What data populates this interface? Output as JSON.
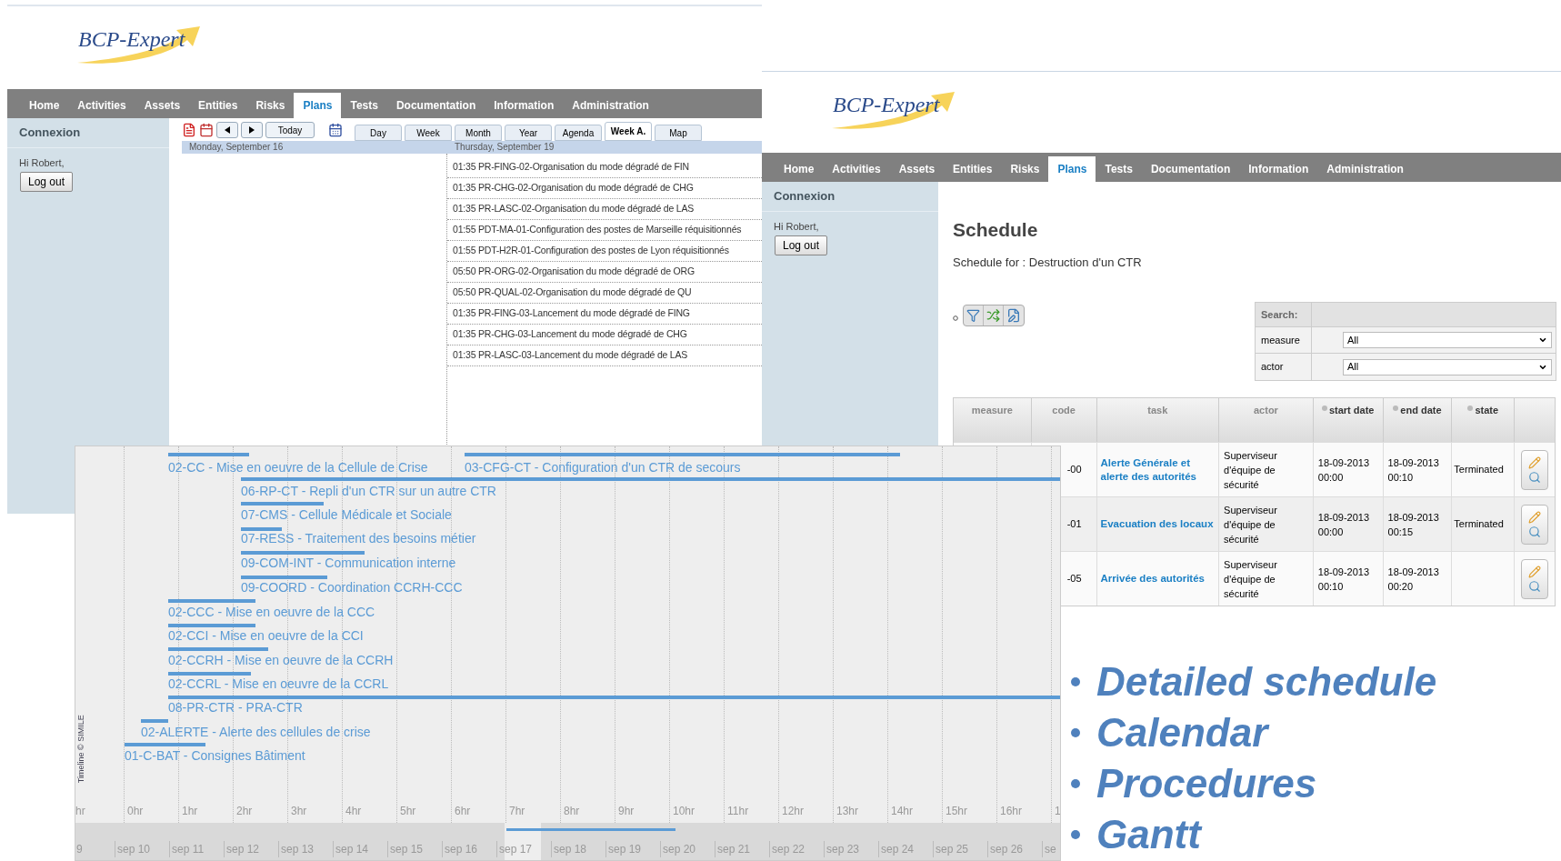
{
  "calendar_window": {
    "logo": "BCP-Expert",
    "nav": [
      {
        "label": "Home",
        "selected": false
      },
      {
        "label": "Activities",
        "selected": false
      },
      {
        "label": "Assets",
        "selected": false
      },
      {
        "label": "Entities",
        "selected": false
      },
      {
        "label": "Risks",
        "selected": false
      },
      {
        "label": "Plans",
        "selected": true
      },
      {
        "label": "Tests",
        "selected": false
      },
      {
        "label": "Documentation",
        "selected": false
      },
      {
        "label": "Information",
        "selected": false
      },
      {
        "label": "Administration",
        "selected": false
      }
    ],
    "sidebar": {
      "title": "Connexion",
      "greeting": "Hi Robert,",
      "logout": "Log out"
    },
    "toolbar": {
      "today": "Today",
      "views": [
        {
          "label": "Day",
          "selected": false
        },
        {
          "label": "Week",
          "selected": false
        },
        {
          "label": "Month",
          "selected": false
        },
        {
          "label": "Year",
          "selected": false
        },
        {
          "label": "Agenda",
          "selected": false
        },
        {
          "label": "Week A.",
          "selected": true
        },
        {
          "label": "Map",
          "selected": false
        }
      ]
    },
    "days": [
      {
        "date": "Monday, September 16"
      },
      {
        "date": "Thursday, September 19",
        "events": [
          "01:35 PR-FING-02-Organisation du mode dégradé de FIN",
          "01:35 PR-CHG-02-Organisation du mode dégradé de CHG",
          "01:35 PR-LASC-02-Organisation du mode dégradé de LAS",
          "01:55 PDT-MA-01-Configuration des postes de Marseille réquisitionnés",
          "01:55 PDT-H2R-01-Configuration des postes de Lyon réquisitionnés",
          "05:50 PR-ORG-02-Organisation du mode dégradé de ORG",
          "05:50 PR-QUAL-02-Organisation du mode dégradé de QU",
          "01:35 PR-FING-03-Lancement du mode dégradé de FING",
          "01:35 PR-CHG-03-Lancement du mode dégradé de CHG",
          "01:35 PR-LASC-03-Lancement du mode dégradé de LAS"
        ]
      }
    ]
  },
  "schedule_window": {
    "logo": "BCP-Expert",
    "nav": [
      {
        "label": "Home",
        "selected": false
      },
      {
        "label": "Activities",
        "selected": false
      },
      {
        "label": "Assets",
        "selected": false
      },
      {
        "label": "Entities",
        "selected": false
      },
      {
        "label": "Risks",
        "selected": false
      },
      {
        "label": "Plans",
        "selected": true
      },
      {
        "label": "Tests",
        "selected": false
      },
      {
        "label": "Documentation",
        "selected": false
      },
      {
        "label": "Information",
        "selected": false
      },
      {
        "label": "Administration",
        "selected": false
      }
    ],
    "sidebar": {
      "title": "Connexion",
      "greeting": "Hi Robert,",
      "logout": "Log out"
    },
    "title": "Schedule",
    "subtitle": "Schedule for : Destruction d'un CTR",
    "search": {
      "title": "Search:",
      "filters": [
        {
          "label": "measure",
          "value": "All"
        },
        {
          "label": "actor",
          "value": "All"
        }
      ]
    },
    "table": {
      "columns": [
        {
          "label": "measure",
          "sortable": false
        },
        {
          "label": "code",
          "sortable": false
        },
        {
          "label": "task",
          "sortable": false
        },
        {
          "label": "actor",
          "sortable": false
        },
        {
          "label": "start date",
          "sortable": true
        },
        {
          "label": "end date",
          "sortable": true
        },
        {
          "label": "state",
          "sortable": true
        }
      ],
      "rows": [
        {
          "code": "-00",
          "task": "Alerte Générale et alerte des autorités",
          "actor": "Superviseur d'équipe de sécurité",
          "start": "18-09-2013 00:00",
          "end": "18-09-2013 00:10",
          "state": "Terminated"
        },
        {
          "code": "-01",
          "task": "Evacuation des locaux",
          "actor": "Superviseur d'équipe de sécurité",
          "start": "18-09-2013 00:00",
          "end": "18-09-2013 00:15",
          "state": "Terminated"
        },
        {
          "code": "-05",
          "task": "Arrivée des autorités",
          "actor": "Superviseur d'équipe de sécurité",
          "start": "18-09-2013 00:10",
          "end": "18-09-2013 00:20"
        }
      ]
    }
  },
  "timeline": {
    "tasks": [
      "02-CC - Mise en oeuvre de la Cellule de Crise",
      "03-CFG-CT - Configuration d'un CTR de secours",
      "06-RP-CT - Repli d'un CTR sur un autre CTR",
      "07-CMS - Cellule Médicale et Sociale",
      "07-RESS - Traitement des besoins métier",
      "09-COM-INT - Communication interne",
      "09-COORD - Coordination CCRH-CCC",
      "02-CCC - Mise en oeuvre de la CCC",
      "02-CCI - Mise en oeuvre de la CCI",
      "02-CCRH - Mise en oeuvre de la CCRH",
      "02-CCRL - Mise en oeuvre de la CCRL",
      "08-PR-CTR - PRA-CTR",
      "02-ALERTE - Alerte des cellules de crise",
      "01-C-BAT - Consignes Bâtiment"
    ],
    "hour_ticks": [
      "hr",
      "0hr",
      "1hr",
      "2hr",
      "3hr",
      "4hr",
      "5hr",
      "6hr",
      "7hr",
      "8hr",
      "9hr",
      "10hr",
      "11hr",
      "12hr",
      "13hr",
      "14hr",
      "15hr",
      "16hr",
      "1"
    ],
    "day_ticks": [
      "9",
      "sep 10",
      "sep 11",
      "sep 12",
      "sep 13",
      "sep 14",
      "sep 15",
      "sep 16",
      "sep 17",
      "sep 18",
      "sep 19",
      "sep 20",
      "sep 21",
      "sep 22",
      "sep 23",
      "sep 24",
      "sep 25",
      "sep 26",
      "se"
    ],
    "credit": "Timeline © SIMILE"
  },
  "features": [
    "Detailed schedule",
    "Calendar",
    "Procedures",
    "Gantt"
  ]
}
